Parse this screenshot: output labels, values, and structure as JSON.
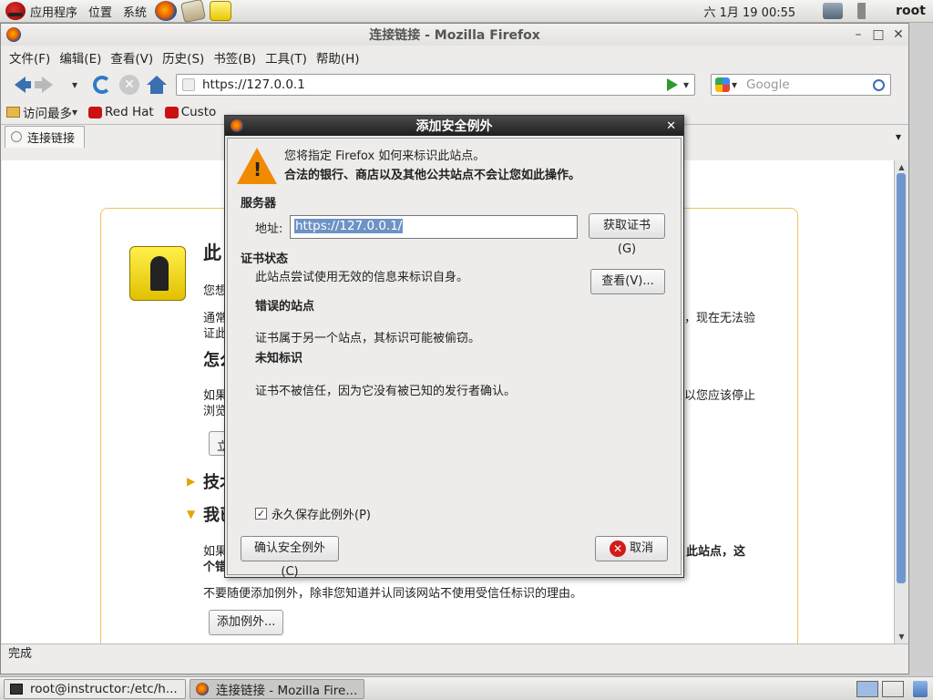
{
  "top_panel": {
    "menus": [
      "应用程序",
      "位置",
      "系统"
    ],
    "clock": "六  1月 19 00:55",
    "user": "root"
  },
  "window": {
    "title": "连接链接 - Mozilla Firefox",
    "menubar": [
      "文件(F)",
      "编辑(E)",
      "查看(V)",
      "历史(S)",
      "书签(B)",
      "工具(T)",
      "帮助(H)"
    ],
    "url": "https://127.0.0.1",
    "search_placeholder": "Google",
    "bookmarks": [
      "访问最多",
      "Red Hat",
      "Custo"
    ],
    "tab_label": "连接链接",
    "status": "完成"
  },
  "page": {
    "title_fragment": "此",
    "line1_fragment": "您想",
    "line2_fragment": "通常",
    "line2_right": "，现在无法验",
    "line3_fragment": "证此",
    "heading2_fragment": "怎么",
    "line4_fragment": "如果",
    "line4_right": "以您应该停止",
    "line5_fragment": "浏览",
    "button_stub": "立",
    "expander1": "技术",
    "expander2": "我已",
    "line6_fragment": "如果",
    "line6_right": "此站点，这",
    "line7_fragment": "个错",
    "warning_line": "不要随便添加例外，除非您知道并认同该网站不使用受信任标识的理由。",
    "add_exception_button": "添加例外..."
  },
  "dialog": {
    "title": "添加安全例外",
    "intro": "您将指定 Firefox 如何来标识此站点。",
    "intro_bold": "合法的银行、商店以及其他公共站点不会让您如此操作。",
    "server_heading": "服务器",
    "address_label": "地址:",
    "address_value": "https://127.0.0.1/",
    "get_cert_button": "获取证书(G)",
    "cert_status_heading": "证书状态",
    "cert_status_text": "此站点尝试使用无效的信息来标识自身。",
    "view_button": "查看(V)...",
    "wrong_site_heading": "错误的站点",
    "wrong_site_text": "证书属于另一个站点，其标识可能被偷窃。",
    "unknown_id_heading": "未知标识",
    "unknown_id_text": "证书不被信任，因为它没有被已知的发行者确认。",
    "permanent_label": "永久保存此例外(P)",
    "permanent_checked": true,
    "confirm_button": "确认安全例外(C)",
    "cancel_button": "取消"
  },
  "taskbar": {
    "items": [
      "root@instructor:/etc/h...",
      "连接链接 - Mozilla Fire..."
    ]
  }
}
